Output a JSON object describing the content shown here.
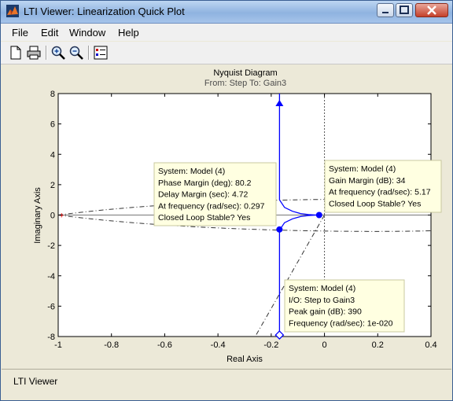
{
  "window": {
    "title": "LTI Viewer: Linearization Quick Plot"
  },
  "menu": {
    "items": [
      "File",
      "Edit",
      "Window",
      "Help"
    ]
  },
  "toolbar": {
    "icons": [
      "new-icon",
      "print-icon",
      "zoom-in-icon",
      "zoom-out-icon",
      "legend-icon"
    ]
  },
  "plot": {
    "title": "Nyquist Diagram",
    "subtitle": "From: Step  To: Gain3",
    "xlabel": "Real Axis",
    "ylabel": "Imaginary Axis"
  },
  "chart_data": {
    "type": "line",
    "title": "Nyquist Diagram",
    "subtitle": "From: Step  To: Gain3",
    "xlabel": "Real Axis",
    "ylabel": "Imaginary Axis",
    "xlim": [
      -1,
      0.4
    ],
    "ylim": [
      -8,
      8
    ],
    "xticks": [
      -1,
      -0.8,
      -0.6,
      -0.4,
      -0.2,
      0,
      0.2,
      0.4
    ],
    "yticks": [
      -8,
      -6,
      -4,
      -2,
      0,
      2,
      4,
      6,
      8
    ],
    "xtick_labels": [
      "-1",
      "-0.8",
      "-0.6",
      "-0.4",
      "-0.2",
      "0",
      "0.2",
      "0.4"
    ],
    "ytick_labels": [
      "-8",
      "-6",
      "-4",
      "-2",
      "0",
      "2",
      "4",
      "6",
      "8"
    ],
    "grid": false,
    "critical_point": [
      -1,
      0
    ],
    "series": [
      {
        "x": [
          -0.169,
          -0.169,
          -0.169,
          -0.169,
          -0.15,
          -0.12,
          -0.09,
          -0.06,
          -0.03,
          -0.01
        ],
        "y": [
          8,
          4,
          2,
          1.0,
          0.5,
          0.25,
          0.1,
          0.03,
          0.0,
          0.0
        ],
        "color": "#0000ff"
      },
      {
        "x": [
          -0.169,
          -0.169,
          -0.169,
          -0.169,
          -0.15,
          -0.12,
          -0.09,
          -0.06,
          -0.03,
          -0.01
        ],
        "y": [
          -8,
          -4,
          -2,
          -1.0,
          -0.5,
          -0.25,
          -0.1,
          -0.03,
          0.0,
          0.0
        ],
        "color": "#0000ff"
      }
    ],
    "markers": [
      {
        "name": "peak-gain-marker",
        "x": -0.169,
        "y": -7.9,
        "shape": "diamond"
      },
      {
        "name": "phase-margin-marker",
        "x": -0.169,
        "y": -0.95,
        "shape": "circle"
      },
      {
        "name": "gain-margin-marker",
        "x": -0.02,
        "y": 0.0,
        "shape": "circle"
      }
    ],
    "annotations": [
      {
        "name": "phase-margin-datatip",
        "lines": [
          "System: Model (4)",
          "Phase Margin (deg): 80.2",
          "Delay Margin (sec): 4.72",
          "At frequency (rad/sec): 0.297",
          "Closed Loop Stable? Yes"
        ]
      },
      {
        "name": "gain-margin-datatip",
        "lines": [
          "System: Model (4)",
          "Gain Margin (dB): 34",
          "At frequency (rad/sec): 5.17",
          "Closed Loop Stable? Yes"
        ]
      },
      {
        "name": "peak-gain-datatip",
        "lines": [
          "System: Model (4)",
          "I/O: Step to Gain3",
          "Peak gain (dB): 390",
          "Frequency (rad/sec): 1e-020"
        ]
      }
    ]
  },
  "status": {
    "text": "LTI Viewer"
  }
}
